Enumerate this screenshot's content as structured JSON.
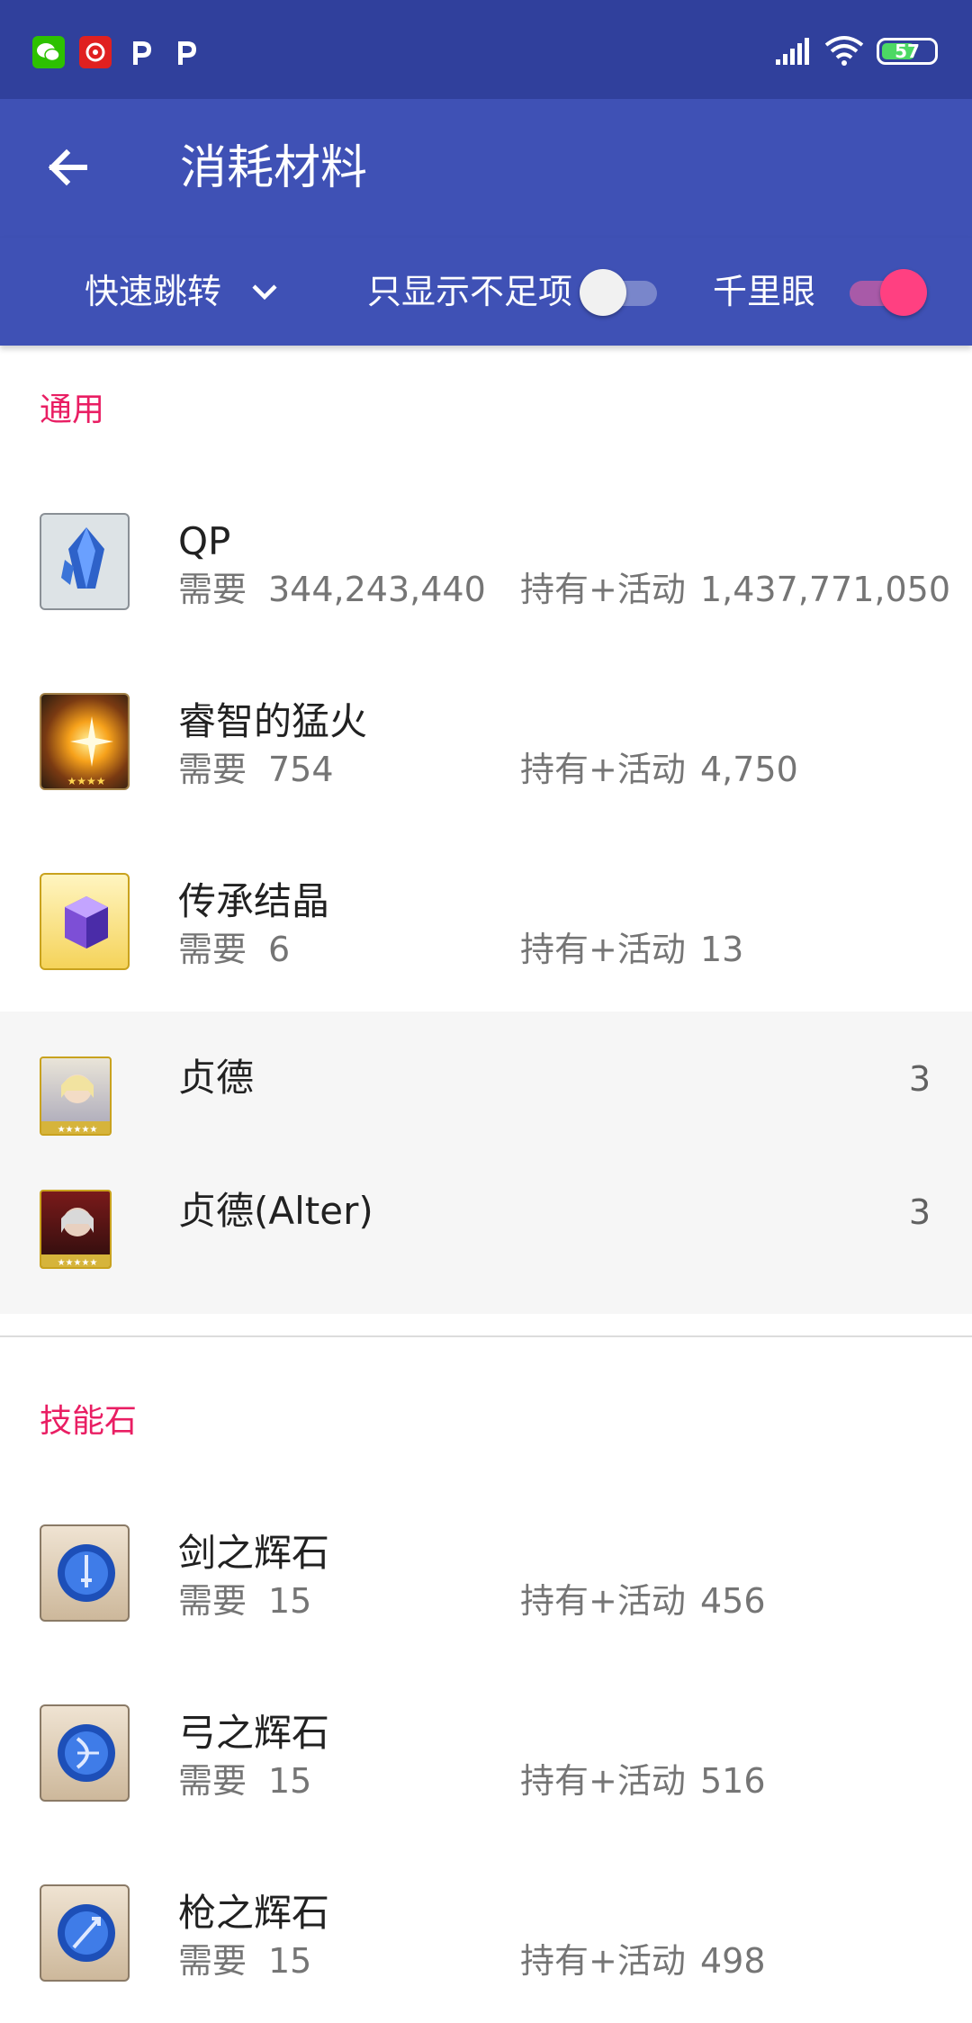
{
  "status_bar": {
    "battery": "57",
    "left_icons": [
      "wechat-icon",
      "netease-icon",
      "p-app-icon",
      "p-app-icon"
    ],
    "right_icons": [
      "signal-icon",
      "wifi-icon",
      "battery-icon"
    ]
  },
  "app_bar": {
    "title": "消耗材料",
    "back_icon": "arrow-left-icon"
  },
  "filter_bar": {
    "jump_label": "快速跳转",
    "only_insufficient_label": "只显示不足项",
    "only_insufficient_on": false,
    "clairvoyance_label": "千里眼",
    "clairvoyance_on": true,
    "accent": "#ff4081"
  },
  "sections": [
    {
      "title": "通用",
      "items": [
        {
          "name": "QP",
          "need_label": "需要",
          "need": "344,243,440",
          "have_label": "持有+活动",
          "have": "1,437,771,050"
        },
        {
          "name": "睿智的猛火",
          "need_label": "需要",
          "need": "754",
          "have_label": "持有+活动",
          "have": "4,750"
        },
        {
          "name": "传承结晶",
          "need_label": "需要",
          "need": "6",
          "have_label": "持有+活动",
          "have": "13"
        }
      ],
      "sub_items": [
        {
          "name": "贞德",
          "count": "3"
        },
        {
          "name": "贞德(Alter)",
          "count": "3"
        }
      ]
    },
    {
      "title": "技能石",
      "items": [
        {
          "name": "剑之辉石",
          "need_label": "需要",
          "need": "15",
          "have_label": "持有+活动",
          "have": "456"
        },
        {
          "name": "弓之辉石",
          "need_label": "需要",
          "need": "15",
          "have_label": "持有+活动",
          "have": "516"
        },
        {
          "name": "枪之辉石",
          "need_label": "需要",
          "need": "15",
          "have_label": "持有+活动",
          "have": "498"
        }
      ]
    }
  ],
  "colors": {
    "primary": "#3f51b5",
    "primary_dark": "#30409c",
    "accent": "#e91e63"
  }
}
